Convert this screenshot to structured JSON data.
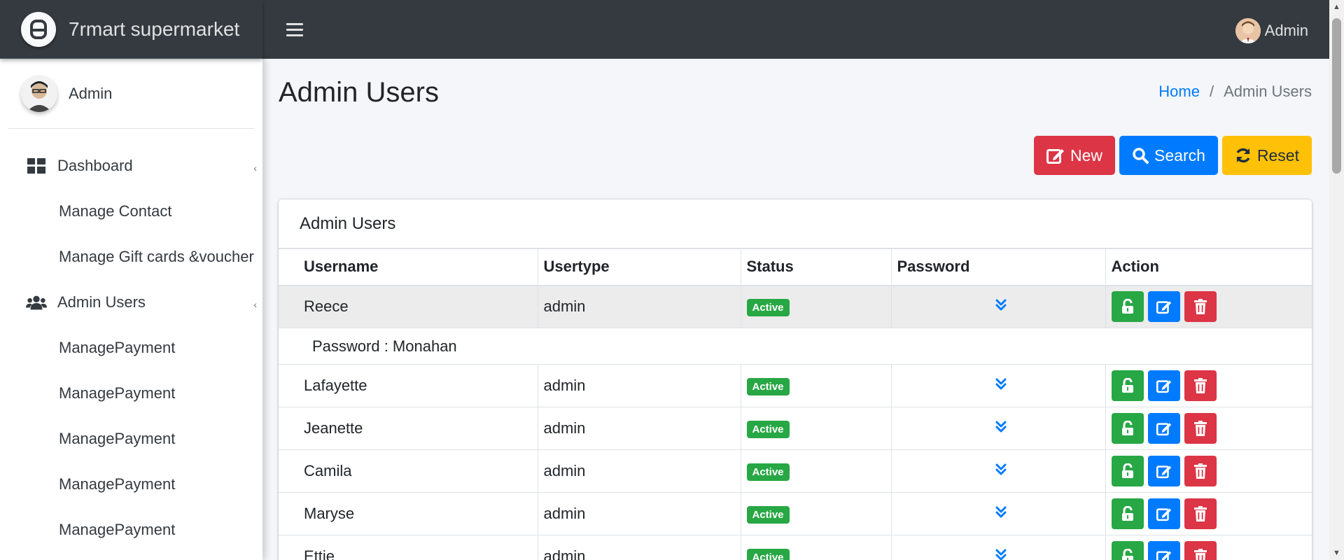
{
  "app": {
    "brand": "7rmart supermarket",
    "navbar_user": "Admin"
  },
  "sidebar": {
    "user_name": "Admin",
    "items": [
      {
        "label": "Dashboard",
        "type": "top",
        "icon": "dashboard-icon"
      },
      {
        "label": "Manage Contact",
        "type": "sub"
      },
      {
        "label": "Manage Gift cards &voucher",
        "type": "sub"
      },
      {
        "label": "Admin Users",
        "type": "top",
        "icon": "users-icon"
      },
      {
        "label": "ManagePayment",
        "type": "sub"
      },
      {
        "label": "ManagePayment",
        "type": "sub"
      },
      {
        "label": "ManagePayment",
        "type": "sub"
      },
      {
        "label": "ManagePayment",
        "type": "sub"
      },
      {
        "label": "ManagePayment",
        "type": "sub"
      }
    ]
  },
  "page": {
    "title": "Admin Users",
    "breadcrumb": {
      "home": "Home",
      "separator": "/",
      "current": "Admin Users"
    }
  },
  "buttons": {
    "new_label": "New",
    "search_label": "Search",
    "reset_label": "Reset"
  },
  "card": {
    "title": "Admin Users"
  },
  "table": {
    "columns": [
      "Username",
      "Usertype",
      "Status",
      "Password",
      "Action"
    ],
    "rows": [
      {
        "username": "Reece",
        "usertype": "admin",
        "status": "Active",
        "expanded": true,
        "detail": "Password : Monahan"
      },
      {
        "username": "Lafayette",
        "usertype": "admin",
        "status": "Active"
      },
      {
        "username": "Jeanette",
        "usertype": "admin",
        "status": "Active"
      },
      {
        "username": "Camila",
        "usertype": "admin",
        "status": "Active"
      },
      {
        "username": "Maryse",
        "usertype": "admin",
        "status": "Active"
      },
      {
        "username": "Ettie",
        "usertype": "admin",
        "status": "Active"
      }
    ]
  },
  "colors": {
    "navbar": "#343a40",
    "primary": "#007bff",
    "danger": "#dc3545",
    "warning": "#ffc107",
    "success": "#28a745"
  }
}
